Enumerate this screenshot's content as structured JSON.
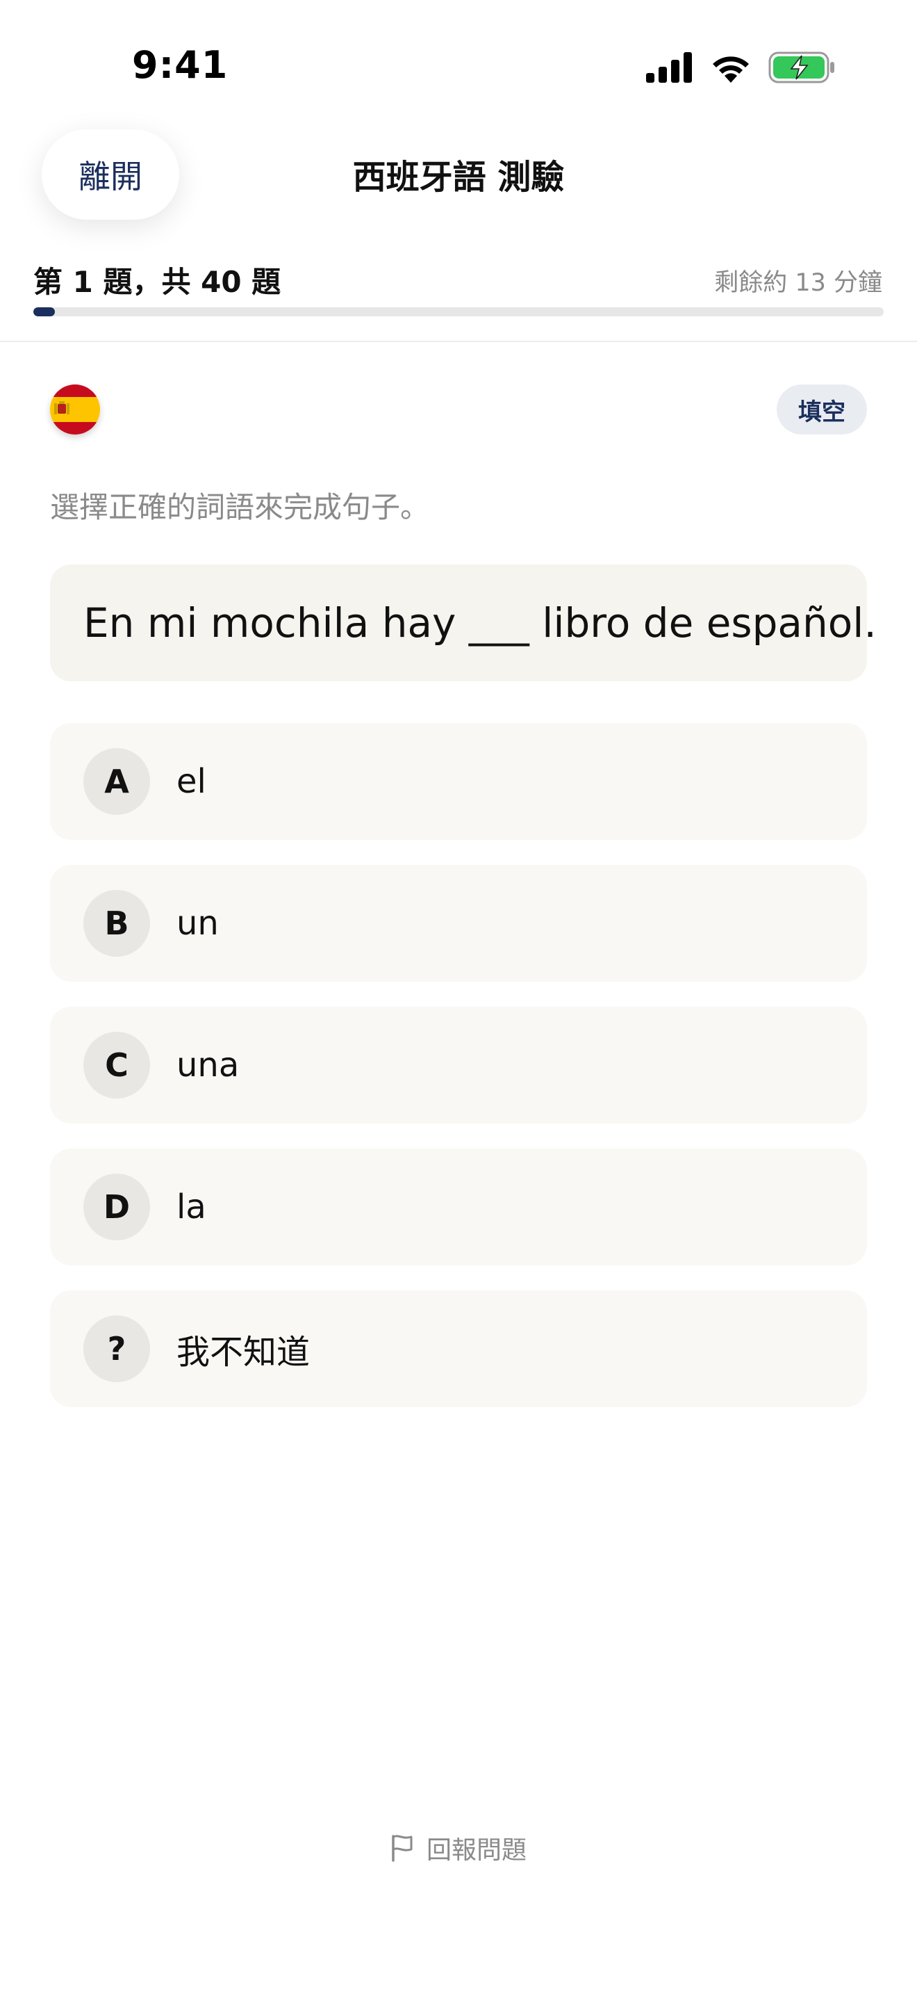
{
  "status_bar": {
    "time": "9:41"
  },
  "header": {
    "leave_label": "離開",
    "title": "西班牙語 測驗"
  },
  "progress": {
    "label": "第 1 題，共 40 題",
    "time_remaining": "剩餘約 13 分鐘",
    "current": 1,
    "total": 40,
    "fraction": 0.025
  },
  "question": {
    "flag_icon": "spain-flag-icon",
    "type_badge": "填空",
    "instruction": "選擇正確的詞語來完成句子。",
    "sentence": "En mi mochila hay ___ libro de español."
  },
  "options": [
    {
      "letter": "A",
      "text": "el"
    },
    {
      "letter": "B",
      "text": "un"
    },
    {
      "letter": "C",
      "text": "una"
    },
    {
      "letter": "D",
      "text": "la"
    },
    {
      "letter": "?",
      "text": "我不知道"
    }
  ],
  "footer": {
    "report_label": "回報問題",
    "report_icon": "flag-outline-icon"
  },
  "colors": {
    "accent": "#1b2f5e",
    "card_bg": "#f6f4ee",
    "option_bg": "#f9f8f4",
    "muted_text": "#8a8a8a"
  }
}
